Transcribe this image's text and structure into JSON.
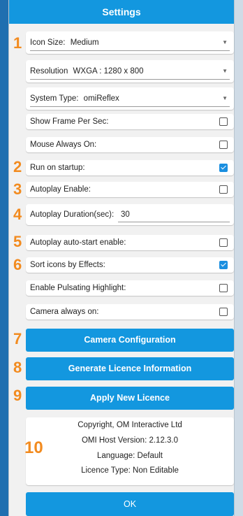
{
  "title": "Settings",
  "dropdowns": [
    {
      "label": "Icon Size:",
      "value": "Medium"
    },
    {
      "label": "Resolution",
      "value": "WXGA : 1280 x 800"
    },
    {
      "label": "System Type:",
      "value": "omiReflex"
    }
  ],
  "checkboxes": [
    {
      "label": "Show Frame Per Sec:",
      "checked": false
    },
    {
      "label": "Mouse Always On:",
      "checked": false
    },
    {
      "label": "Run on startup:",
      "checked": true
    },
    {
      "label": "Autoplay Enable:",
      "checked": false
    },
    {
      "label": "Autoplay auto-start enable:",
      "checked": false
    },
    {
      "label": "Sort icons by Effects:",
      "checked": true
    },
    {
      "label": "Enable Pulsating Highlight:",
      "checked": false
    },
    {
      "label": "Camera always on:",
      "checked": false
    }
  ],
  "duration": {
    "label": "Autoplay Duration(sec):",
    "value": "30"
  },
  "buttons": {
    "camera": "Camera Configuration",
    "generate": "Generate Licence Information",
    "apply": "Apply New Licence",
    "ok": "OK"
  },
  "info": {
    "copyright": "Copyright, OM Interactive Ltd",
    "version": "OMI Host Version: 2.12.3.0",
    "language": "Language: Default",
    "licence": "Licence Type: Non Editable"
  },
  "markers": [
    "1",
    "2",
    "3",
    "4",
    "5",
    "6",
    "7",
    "8",
    "9",
    "10"
  ],
  "colors": {
    "accent": "#1397df",
    "marker": "#f28b1f",
    "check": "#1a8fe0"
  }
}
